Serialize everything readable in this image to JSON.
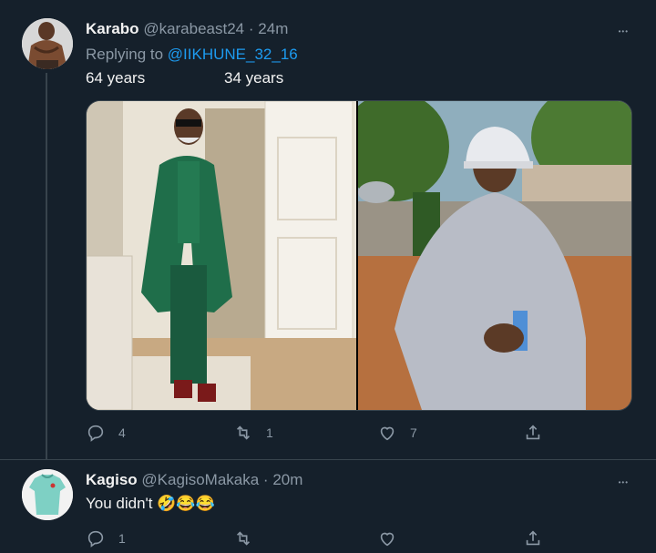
{
  "tweets": [
    {
      "display_name": "Karabo",
      "handle": "@karabeast24",
      "separator": "·",
      "time": "24m",
      "replying_prefix": "Replying to",
      "replying_handle": "@IIKHUNE_32_16",
      "caption_left": "64 years",
      "caption_right": "34 years",
      "actions": {
        "reply_count": "4",
        "retweet_count": "1",
        "like_count": "7"
      }
    },
    {
      "display_name": "Kagiso",
      "handle": "@KagisoMakaka",
      "separator": "·",
      "time": "20m",
      "text": "You didn't 🤣😂😂",
      "actions": {
        "reply_count": "1",
        "retweet_count": "",
        "like_count": ""
      }
    }
  ],
  "more_glyph": "•••",
  "colors": {
    "background": "#15202b",
    "link": "#1d9bf0",
    "muted": "#8b98a5",
    "divider": "#38444d"
  }
}
